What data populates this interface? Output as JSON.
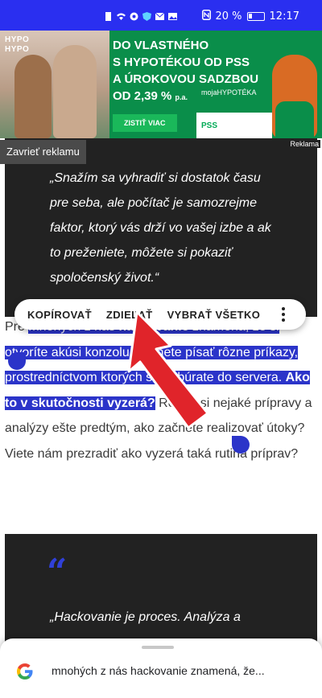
{
  "status_bar": {
    "battery_text": "20 %",
    "time": "12:17"
  },
  "ad": {
    "brand_lines": [
      "HYPO",
      "HYPO"
    ],
    "headline": [
      "DO VLASTNÉHO",
      "S HYPOTÉKOU OD PSS",
      "A ÚROKOVOU SADZBOU"
    ],
    "rate_prefix": "OD",
    "rate": "2,39 %",
    "rate_suffix": "p.a.",
    "cta": "ZISTIŤ VIAC",
    "product": "mojaHYPOTÉKA",
    "logo": "PSS",
    "label": "Reklama",
    "close_label": "Zavrieť reklamu"
  },
  "quote1": {
    "lines": [
      "„Snažím sa vyhradiť si dostatok času",
      "pre seba, ale počítač je samozrejme",
      "faktor, ktorý vás drží vo vašej izbe a ak",
      "to preženiete, môžete si pokaziť",
      "spoločenský život.“"
    ]
  },
  "selection_toolbar": {
    "copy": "KOPÍROVAŤ",
    "share": "ZDIEĽAŤ",
    "select_all": "VYBRAŤ VŠETKO",
    "more_icon": "more-vert-icon"
  },
  "paragraph": {
    "lead": "Pre ",
    "sel_1": "mnohých z nás ",
    "sel_bold_1": "hackovanie",
    "sel_2": " znamená, že si otvoríte akúsi konzolu, začnete písať rôzne príkazy, prostredníctvom ktorých sa nabúrate do servera. ",
    "sel_bold_2": "Ako to v skutočnosti vyzerá?",
    "rest": " Robíte si nejaké prípravy a analýzy ešte predtým, ako začnete realizovať útoky? Viete nám prezradiť ako vyzerá taká rutina príprav?"
  },
  "quote2": {
    "mark": "“",
    "first_line": "„Hackovanie je proces. Analýza a"
  },
  "google_sheet": {
    "logo_icon": "google-g-icon",
    "query": "mnohých z nás hackovanie znamená, že..."
  },
  "colors": {
    "status_bar": "#2a2ff0",
    "ad_green": "#0a8e4a",
    "selection": "#2b34c9",
    "quote_bg": "#222222",
    "arrow_red": "#e0242a"
  }
}
